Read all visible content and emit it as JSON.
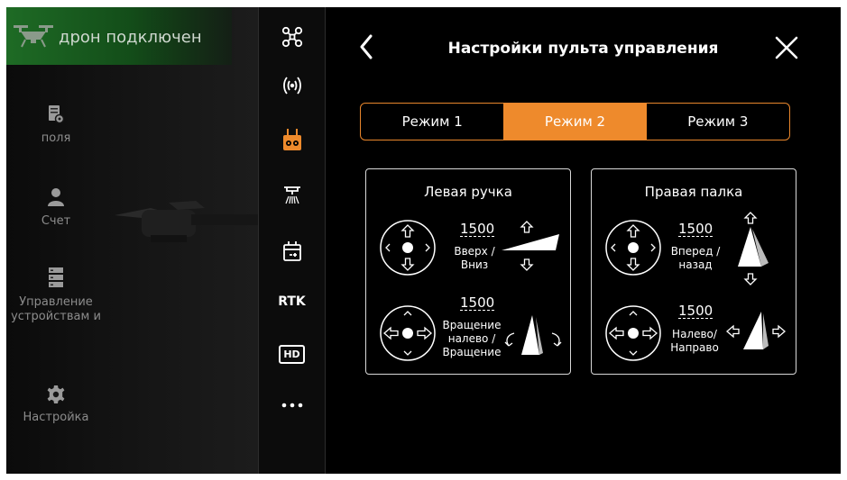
{
  "status": {
    "text": "дрон подключен",
    "color": "#1e6b25"
  },
  "left_nav": [
    {
      "label": "поля",
      "icon": "fields-icon"
    },
    {
      "label": "Счет",
      "icon": "user-icon"
    },
    {
      "label": "Управление устройствам и",
      "icon": "device-icon"
    },
    {
      "label": "Настройка",
      "icon": "gear-icon"
    }
  ],
  "side_strip": [
    {
      "icon": "drone-icon"
    },
    {
      "icon": "signal-icon"
    },
    {
      "icon": "remote-controller-icon",
      "active": true
    },
    {
      "icon": "spray-icon"
    },
    {
      "icon": "battery-icon"
    },
    {
      "label": "RTK"
    },
    {
      "label": "HD"
    },
    {
      "icon": "more-icon"
    }
  ],
  "panel": {
    "title": "Настройки пульта управления",
    "accent": "#ee8a2c"
  },
  "modes": {
    "options": [
      "Режим 1",
      "Режим 2",
      "Режим 3"
    ],
    "selected": "Режим 2"
  },
  "left_stick": {
    "title": "Левая ручка",
    "vertical": {
      "value": "1500",
      "label": "Вверх / Вниз"
    },
    "horizontal": {
      "value": "1500",
      "label": "Вращение налево / Вращение"
    }
  },
  "right_stick": {
    "title": "Правая палка",
    "vertical": {
      "value": "1500",
      "label": "Вперед / назад"
    },
    "horizontal": {
      "value": "1500",
      "label": "Налево/ Направо"
    }
  }
}
